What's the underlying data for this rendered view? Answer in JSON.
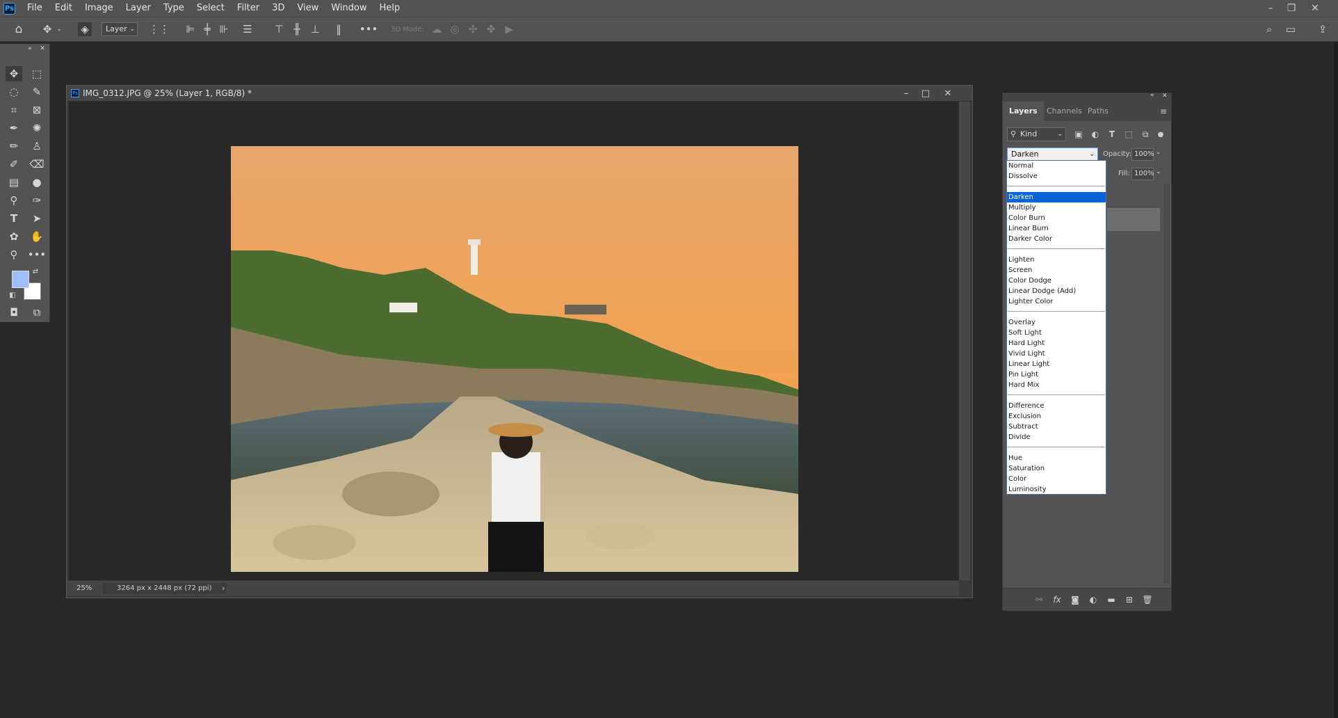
{
  "menubar": {
    "logo": "Ps",
    "items": [
      "File",
      "Edit",
      "Image",
      "Layer",
      "Type",
      "Select",
      "Filter",
      "3D",
      "View",
      "Window",
      "Help"
    ]
  },
  "optionsbar": {
    "layer_select": "Layer",
    "mode_3d_label": "3D Mode:"
  },
  "document": {
    "title": "IMG_0312.JPG @ 25% (Layer 1, RGB/8) *",
    "zoom": "25%",
    "size": "3264 px x 2448 px (72 ppi)",
    "status_arrow": "›"
  },
  "colors": {
    "foreground": "#9ebdfb",
    "background": "#ffffff",
    "accent": "#0a64d8"
  },
  "layers_panel": {
    "tabs": [
      "Layers",
      "Channels",
      "Paths"
    ],
    "kind_filter": "Kind",
    "blend_mode": "Darken",
    "opacity_label": "Opacity:",
    "opacity_value": "100%",
    "fill_label": "Fill:",
    "fill_value": "100%"
  },
  "blend_dropdown": {
    "selected": "Darken",
    "groups": [
      [
        "Normal",
        "Dissolve"
      ],
      [
        "Darken",
        "Multiply",
        "Color Burn",
        "Linear Burn",
        "Darker Color"
      ],
      [
        "Lighten",
        "Screen",
        "Color Dodge",
        "Linear Dodge (Add)",
        "Lighter Color"
      ],
      [
        "Overlay",
        "Soft Light",
        "Hard Light",
        "Vivid Light",
        "Linear Light",
        "Pin Light",
        "Hard Mix"
      ],
      [
        "Difference",
        "Exclusion",
        "Subtract",
        "Divide"
      ],
      [
        "Hue",
        "Saturation",
        "Color",
        "Luminosity"
      ]
    ]
  }
}
